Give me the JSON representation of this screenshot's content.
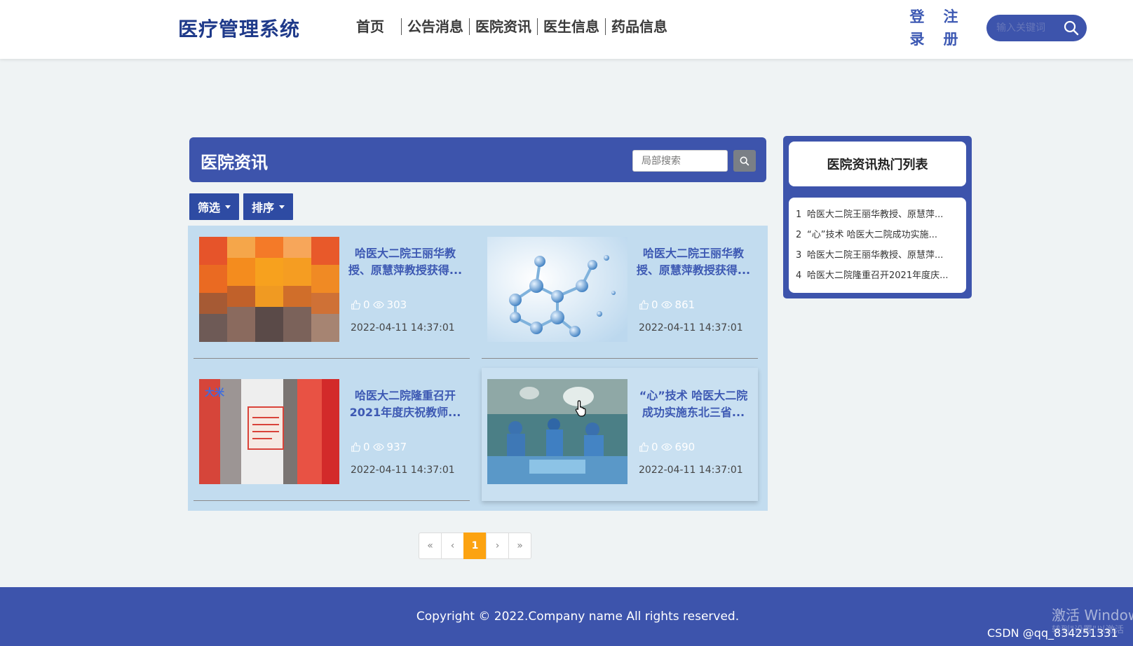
{
  "header": {
    "logo": "医疗管理系统",
    "nav": [
      "首页",
      "公告消息",
      "医院资讯",
      "医生信息",
      "药品信息"
    ],
    "login": "登录",
    "register": "注册",
    "search_placeholder": "输入关键词"
  },
  "panel": {
    "title": "医院资讯",
    "local_search_placeholder": "局部搜索",
    "filter_label": "筛选",
    "sort_label": "排序"
  },
  "cards": [
    {
      "title": "哈医大二院王丽华教授、原慧萍教授获得...",
      "likes": "0",
      "views": "303",
      "date": "2022-04-11 14:37:01",
      "image": "blurred-orange-photo"
    },
    {
      "title": "哈医大二院王丽华教授、原慧萍教授获得...",
      "likes": "0",
      "views": "861",
      "date": "2022-04-11 14:37:01",
      "image": "molecule-photo"
    },
    {
      "title": "哈医大二院隆重召开2021年度庆祝教师...",
      "likes": "0",
      "views": "937",
      "date": "2022-04-11 14:37:01",
      "image": "doctors-photo"
    },
    {
      "title": "“心”技术 哈医大二院成功实施东北三省...",
      "likes": "0",
      "views": "690",
      "date": "2022-04-11 14:37:01",
      "image": "surgery-photo"
    }
  ],
  "pagination": {
    "first": "«",
    "prev": "‹",
    "current": "1",
    "next": "›",
    "last": "»"
  },
  "sidebar": {
    "title": "医院资讯热门列表",
    "items": [
      {
        "no": "1",
        "text": "哈医大二院王丽华教授、原慧萍..."
      },
      {
        "no": "2",
        "text": "“心”技术 哈医大二院成功实施..."
      },
      {
        "no": "3",
        "text": "哈医大二院王丽华教授、原慧萍..."
      },
      {
        "no": "4",
        "text": "哈医大二院隆重召开2021年度庆..."
      }
    ]
  },
  "footer": {
    "copyright": "Copyright © 2022.Company name All rights reserved.",
    "watermark_line1": "激活 Windows",
    "watermark_line2": "转到\"设置\"以激活",
    "csdn": "CSDN @qq_834251331"
  },
  "colors": {
    "primary": "#3d54ac",
    "accent": "#fca311",
    "card_bg": "#c2dcef"
  }
}
